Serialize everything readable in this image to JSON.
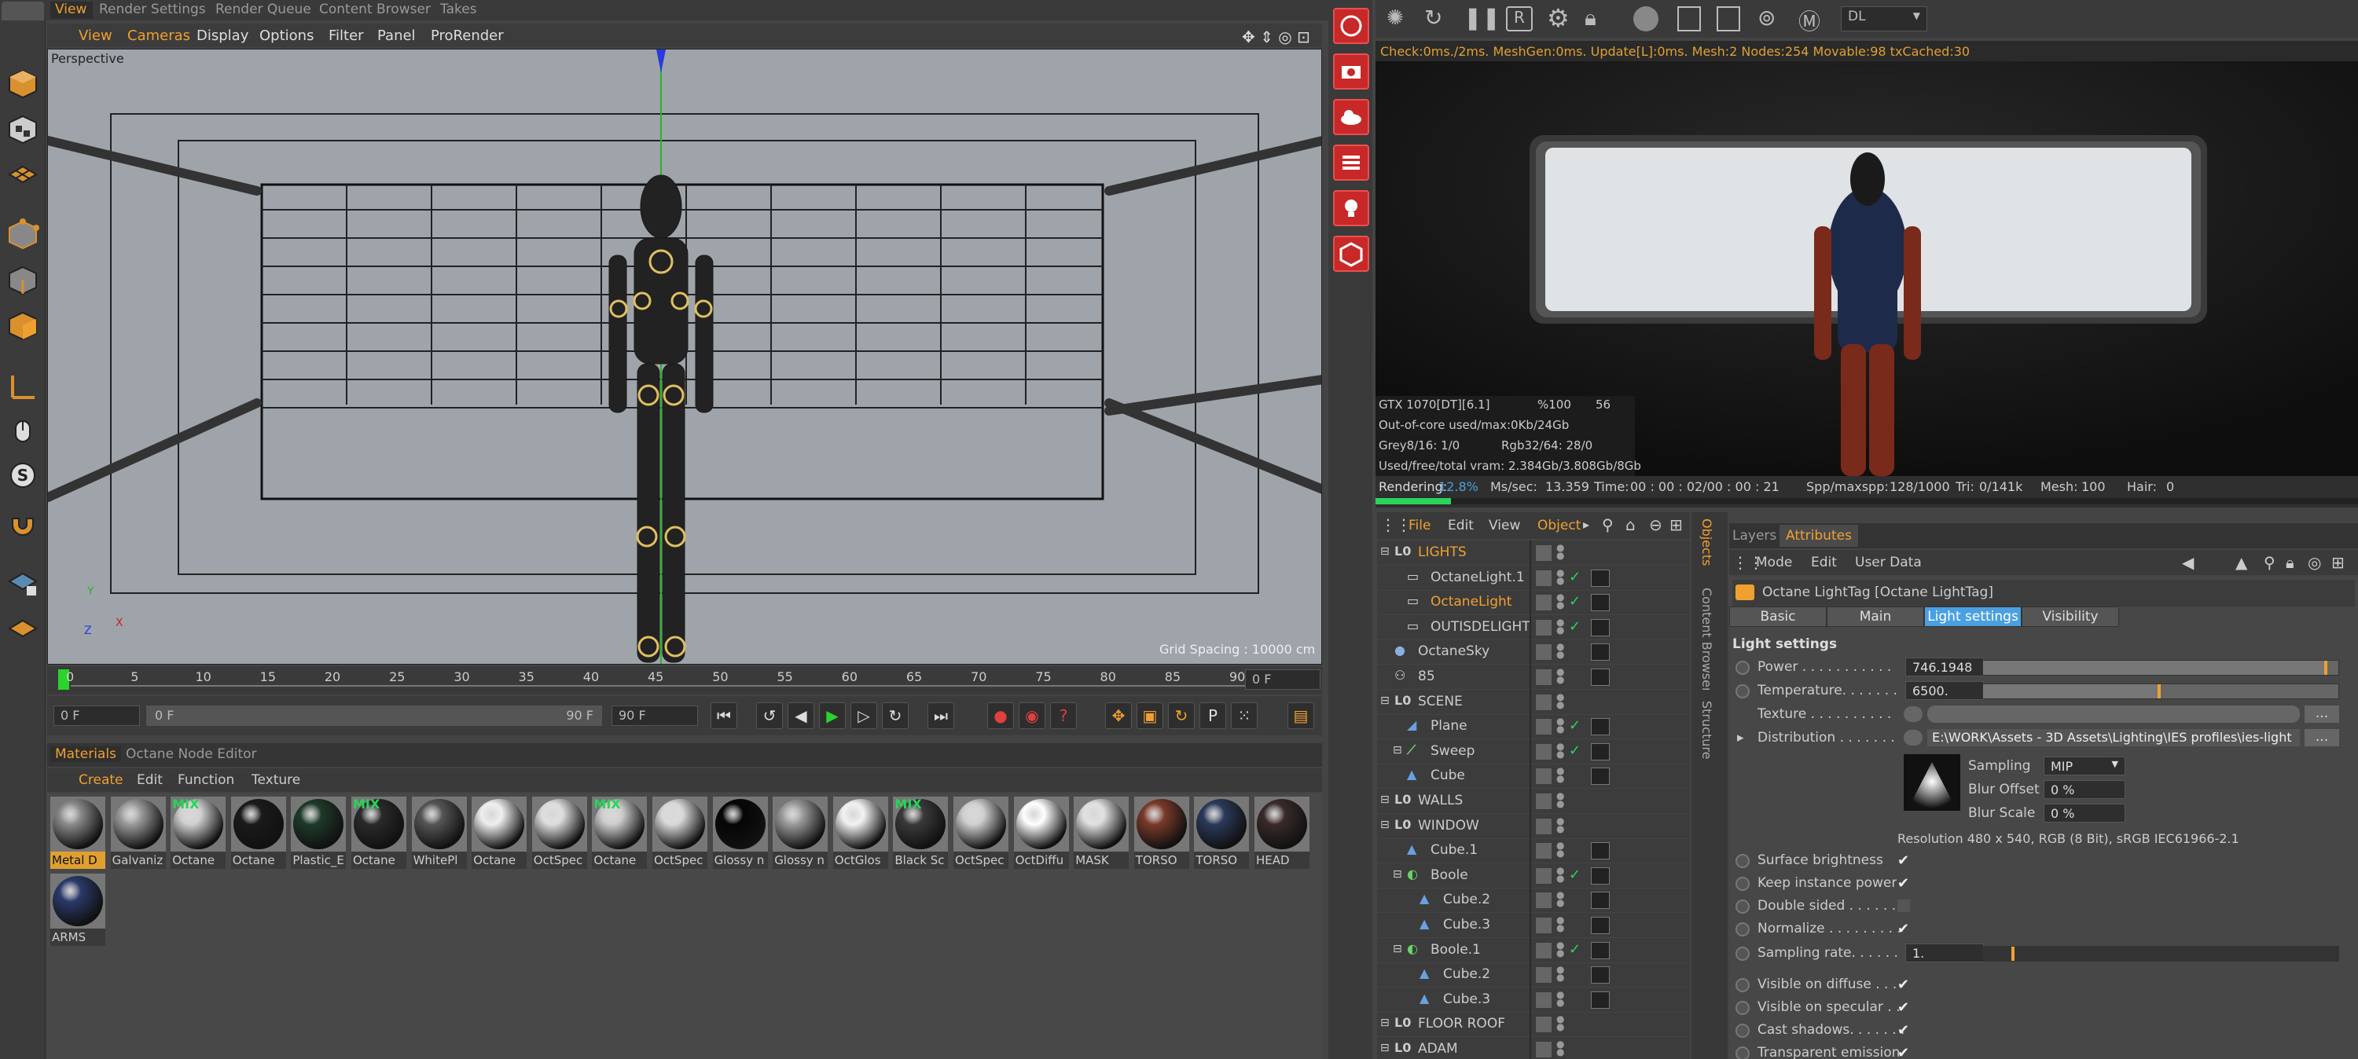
{
  "top_tabs": [
    "View",
    "Render Settings",
    "Render Queue",
    "Content Browser",
    "Takes"
  ],
  "viewport_menu": [
    "View",
    "Cameras",
    "Display",
    "Options",
    "Filter",
    "Panel",
    "ProRender"
  ],
  "viewport": {
    "label": "Perspective",
    "grid_spacing": "Grid Spacing : 10000 cm",
    "axis_y": "Y",
    "axis_x": "X",
    "axis_z": "Z"
  },
  "timeline": {
    "ticks": [
      "0",
      "5",
      "10",
      "15",
      "20",
      "25",
      "30",
      "35",
      "40",
      "45",
      "50",
      "55",
      "60",
      "65",
      "70",
      "75",
      "80",
      "85",
      "90"
    ],
    "frame_right": "0 F",
    "start_field": "0 F",
    "range_left": "0 F",
    "range_right": "90 F",
    "end_field": "90 F"
  },
  "materials_tabs": [
    "Materials",
    "Octane Node Editor"
  ],
  "materials_menu": [
    "Create",
    "Edit",
    "Function",
    "Texture"
  ],
  "materials": [
    {
      "name": "Metal D",
      "color": "#8a8a8a",
      "mix": false
    },
    {
      "name": "Galvaniz",
      "color": "#9a9a9a",
      "mix": false
    },
    {
      "name": "Octane",
      "color": "#cfcfcf",
      "mix": true
    },
    {
      "name": "Octane",
      "color": "#1a1a1a",
      "mix": false
    },
    {
      "name": "Plastic_E",
      "color": "#1e3a2a",
      "mix": false
    },
    {
      "name": "Octane",
      "color": "#2a2a2a",
      "mix": true
    },
    {
      "name": "WhitePl",
      "color": "#555555",
      "mix": false
    },
    {
      "name": "Octane",
      "color": "#eeeeee",
      "mix": false
    },
    {
      "name": "OctSpec",
      "color": "#dddddd",
      "mix": false
    },
    {
      "name": "Octane",
      "color": "#cccccc",
      "mix": true
    },
    {
      "name": "OctSpec",
      "color": "#d8d8d8",
      "mix": false
    },
    {
      "name": "Glossy n",
      "color": "#050505",
      "mix": false
    },
    {
      "name": "Glossy n",
      "color": "#9a9a9a",
      "mix": false
    },
    {
      "name": "OctGlos",
      "color": "#f2f2f2",
      "mix": false
    },
    {
      "name": "Black Sc",
      "color": "#3a3a3a",
      "mix": true
    },
    {
      "name": "OctSpec",
      "color": "#cfcfcf",
      "mix": false
    },
    {
      "name": "OctDiffu",
      "color": "#ffffff",
      "mix": false
    },
    {
      "name": "MASK",
      "color": "#e0e0e0",
      "mix": false
    },
    {
      "name": "TORSO",
      "color": "#7a3a2a",
      "mix": false
    },
    {
      "name": "TORSO",
      "color": "#2a3a5a",
      "mix": false
    },
    {
      "name": "HEAD",
      "color": "#3a2a2a",
      "mix": false
    },
    {
      "name": "ARMS",
      "color": "#2a3a6a",
      "mix": false
    }
  ],
  "live_viewer": {
    "dropdown": "DL",
    "status": "Check:0ms./2ms. MeshGen:0ms. Update[L]:0ms. Mesh:2 Nodes:254 Movable:98 txCached:30",
    "gpu_name": "GTX 1070[DT][6.1]",
    "gpu_pct": "%100",
    "gpu_temp": "56",
    "out_of_core": "Out-of-core used/max:0Kb/24Gb",
    "grey": "Grey8/16: 1/0",
    "rgb": "Rgb32/64: 28/0",
    "vram": "Used/free/total vram: 2.384Gb/3.808Gb/8Gb",
    "rendering_label": "Rendering:",
    "rendering_pct": "12.8%",
    "ms_label": "Ms/sec:",
    "ms_value": "13.359",
    "time_label": "Time:",
    "time_value": "00 : 00 : 02/00 : 00 : 21",
    "spp_label": "Spp/maxspp:",
    "spp_value": "128/1000",
    "tri_label": "Tri:",
    "tri_value": "0/141k",
    "mesh_label": "Mesh:",
    "mesh_value": "100",
    "hair_label": "Hair:",
    "hair_value": "0",
    "render_progress": 0.128
  },
  "object_manager": {
    "menu": [
      "File",
      "Edit",
      "View",
      "Objects"
    ],
    "side_tabs": [
      "Objects",
      "Content Browser",
      "Structure"
    ],
    "rows": [
      {
        "name": "LIGHTS",
        "indent": 0,
        "kind": "null",
        "highlight": true
      },
      {
        "name": "OctaneLight.1",
        "indent": 1,
        "kind": "light",
        "highlight": false
      },
      {
        "name": "OctaneLight",
        "indent": 1,
        "kind": "light",
        "highlight": true
      },
      {
        "name": "OUTISDELIGHT",
        "indent": 1,
        "kind": "light",
        "highlight": false
      },
      {
        "name": "OctaneSky",
        "indent": 0,
        "kind": "sky",
        "highlight": false
      },
      {
        "name": "85",
        "indent": 0,
        "kind": "camera",
        "highlight": false
      },
      {
        "name": "SCENE",
        "indent": 0,
        "kind": "null",
        "highlight": false
      },
      {
        "name": "Plane",
        "indent": 1,
        "kind": "plane",
        "highlight": false
      },
      {
        "name": "Sweep",
        "indent": 1,
        "kind": "sweep",
        "highlight": false
      },
      {
        "name": "Cube",
        "indent": 1,
        "kind": "cube",
        "highlight": false
      },
      {
        "name": "WALLS",
        "indent": 0,
        "kind": "null",
        "highlight": false
      },
      {
        "name": "WINDOW",
        "indent": 0,
        "kind": "null",
        "highlight": false
      },
      {
        "name": "Cube.1",
        "indent": 1,
        "kind": "cube",
        "highlight": false
      },
      {
        "name": "Boole",
        "indent": 1,
        "kind": "boole",
        "highlight": false
      },
      {
        "name": "Cube.2",
        "indent": 2,
        "kind": "cube",
        "highlight": false
      },
      {
        "name": "Cube.3",
        "indent": 2,
        "kind": "cube",
        "highlight": false
      },
      {
        "name": "Boole.1",
        "indent": 1,
        "kind": "boole",
        "highlight": false
      },
      {
        "name": "Cube.2",
        "indent": 2,
        "kind": "cube",
        "highlight": false
      },
      {
        "name": "Cube.3",
        "indent": 2,
        "kind": "cube",
        "highlight": false
      },
      {
        "name": "FLOOR ROOF",
        "indent": 0,
        "kind": "null",
        "highlight": false
      },
      {
        "name": "ADAM",
        "indent": 0,
        "kind": "null",
        "highlight": false
      }
    ]
  },
  "attributes": {
    "tabs": [
      "Layers",
      "Attributes"
    ],
    "menu": [
      "Mode",
      "Edit",
      "User Data"
    ],
    "title": "Octane LightTag [Octane LightTag]",
    "subtabs": [
      "Basic",
      "Main",
      "Light settings",
      "Visibility"
    ],
    "section": "Light settings",
    "power_label": "Power . . . . . . . . . . .",
    "power_value": "746.1948",
    "power_level": 0.97,
    "temperature_label": "Temperature. . . . . . .",
    "temperature_value": "6500.",
    "temperature_level": 0.5,
    "texture_label": "Texture . . . . . . . . . .",
    "distribution_label": "Distribution . . . . . . .",
    "distribution_path": "E:\\WORK\\Assets - 3D Assets\\Lighting\\IES profiles\\ies-light",
    "sampling_label": "Sampling",
    "sampling_value": "MIP",
    "blur_offset_label": "Blur Offset",
    "blur_offset_value": "0 %",
    "blur_scale_label": "Blur Scale",
    "blur_scale_value": "0 %",
    "resolution": "Resolution 480 x 540, RGB (8 Bit), sRGB IEC61966-2.1",
    "checks": [
      {
        "label": "Surface brightness",
        "checked": true
      },
      {
        "label": "Keep instance power",
        "checked": true
      },
      {
        "label": "Double sided . . . . . . .",
        "checked": false
      },
      {
        "label": "Normalize . . . . . . . . .",
        "checked": true
      }
    ],
    "sampling_rate_label": "Sampling rate. . . . . .",
    "sampling_rate_value": "1.",
    "checks2": [
      {
        "label": "Visible on diffuse . . .",
        "checked": true
      },
      {
        "label": "Visible on specular . .",
        "checked": true
      },
      {
        "label": "Cast shadows. . . . . . .",
        "checked": true
      },
      {
        "label": "Transparent emission",
        "checked": true
      }
    ]
  }
}
